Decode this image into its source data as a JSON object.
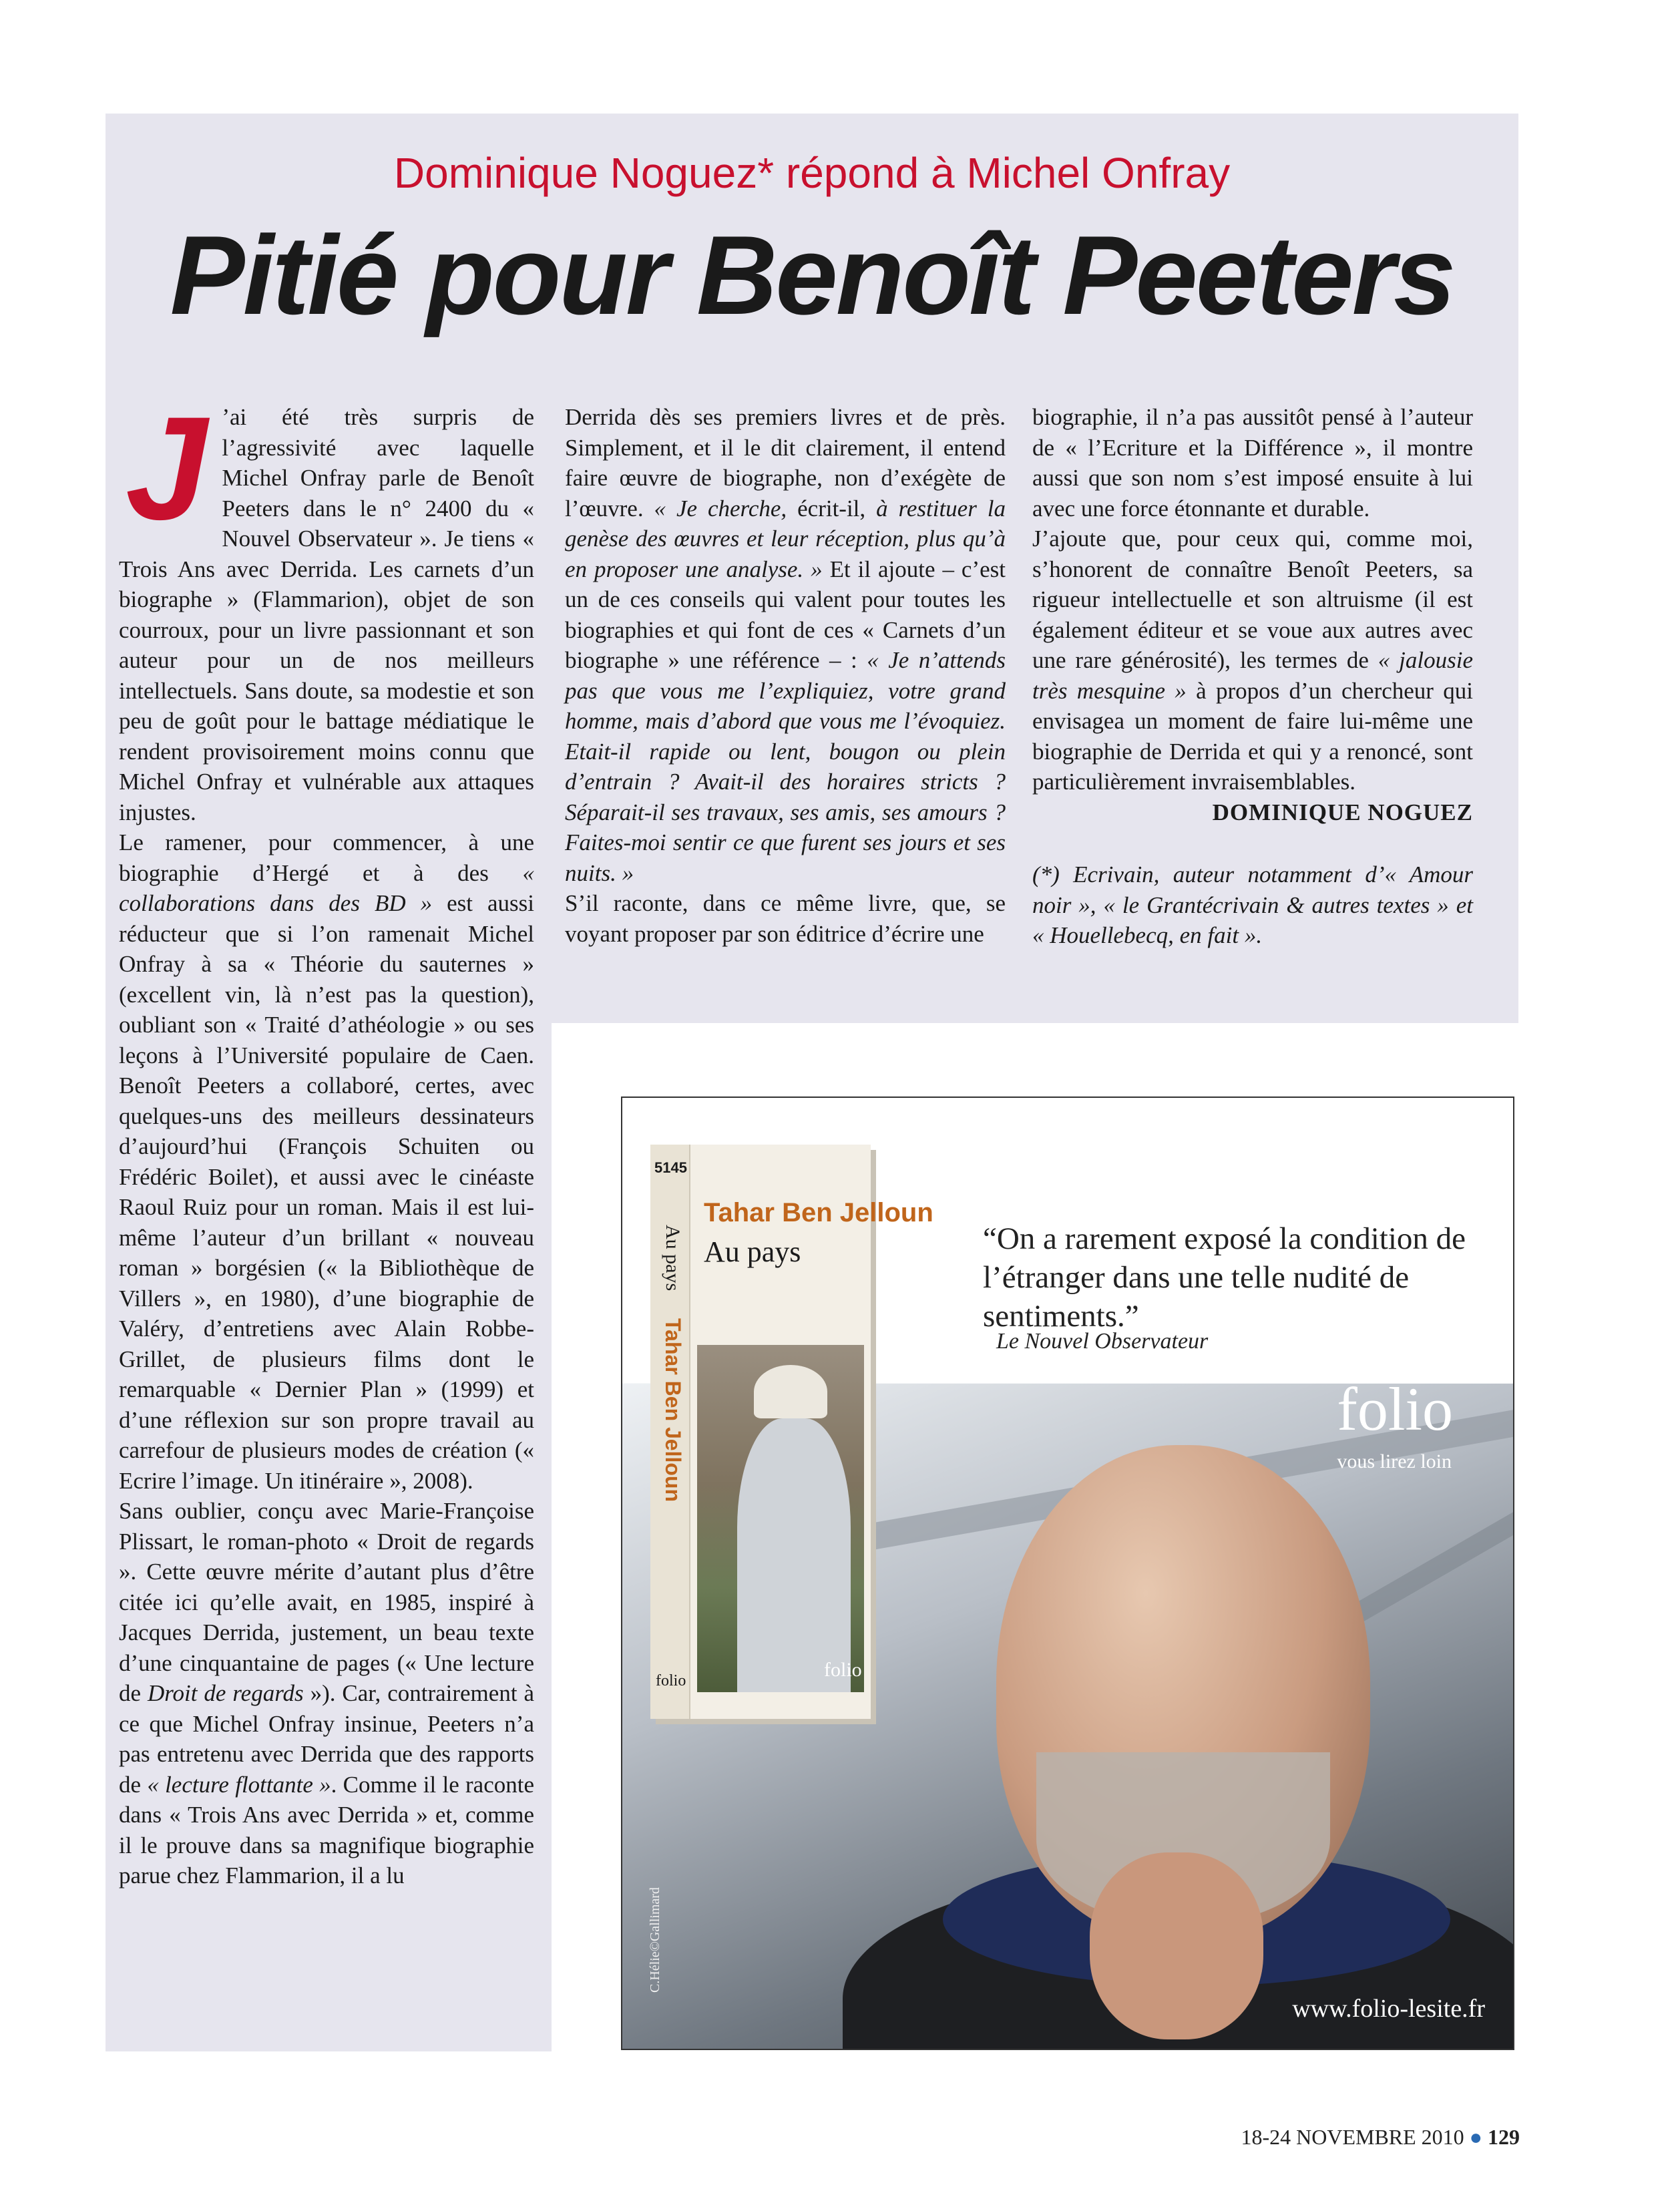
{
  "header": {
    "kicker": "Dominique Noguez* répond à Michel Onfray",
    "headline": "Pitié pour Benoît Peeters"
  },
  "article": {
    "dropcap": "J",
    "col1": {
      "p1_rest": "’ai été très surpris de l’agressivité avec laquelle Michel Onfray parle de Benoît Peeters dans le n° 2400 du « Nouvel Observateur ». Je tiens « Trois Ans avec Derrida. Les carnets d’un biographe » (Flammarion), objet de son courroux, pour un livre passionnant et son auteur pour un de nos meilleurs intellectuels. Sans doute, sa modestie et son peu de goût pour le battage médiatique le rendent provisoirement moins connu que Michel Onfray et vulnérable aux attaques injustes.",
      "p2_a": "Le ramener, pour commencer, à une biographie d’Hergé et à des ",
      "p2_em": "« collaborations dans des BD »",
      "p2_b": " est aussi réducteur que si l’on ramenait Michel Onfray à sa « Théorie du sauternes » (excellent vin, là n’est pas la question), oubliant son « Traité d’athéologie » ou ses leçons à l’Université populaire de Caen. Benoît Peeters a collaboré, certes, avec quelques-uns des meilleurs dessinateurs d’aujourd’hui (François Schuiten ou Frédéric Boilet), et aussi avec le cinéaste Raoul Ruiz pour un roman. Mais il est lui-même l’auteur d’un brillant « nouveau roman » borgésien (« la Bibliothèque de Villers », en 1980), d’une biographie de Valéry, d’entretiens avec Alain Robbe-Grillet, de plusieurs films dont le remarquable « Dernier Plan » (1999) et d’une réflexion sur son propre travail au carrefour de plusieurs modes de création (« Ecrire l’image. Un itinéraire », 2008).",
      "p3_a": "Sans oublier, conçu avec Marie-Françoise Plissart, le roman-photo « Droit de regards ». Cette œuvre mérite d’autant plus d’être citée ici qu’elle avait, en 1985, inspiré à Jacques Derrida, justement, un beau texte d’une cinquantaine de pages (« Une lecture de ",
      "p3_em": "Droit de regards",
      "p3_b": " »). Car, contrairement à ce que Michel Onfray insinue, Peeters n’a pas entretenu avec Derrida que des rapports de ",
      "p3_em2": "« lecture flottante »",
      "p3_c": ". Comme il le raconte dans « Trois Ans avec Derrida » et, comme il le prouve dans sa magnifique biographie parue chez Flammarion, il a lu"
    },
    "col2": {
      "p1_a": "Derrida dès ses premiers livres et de près. Simplement, et il le dit clairement, il entend faire œuvre de biographe, non d’exégète de l’œuvre. ",
      "p1_em1": "« Je cherche,",
      "p1_b": " écrit-il, ",
      "p1_em2": "à restituer la genèse des œuvres et leur réception, plus qu’à en proposer une analyse. »",
      "p1_c": " Et il ajoute – c’est un de ces conseils qui valent pour toutes les biographies et qui font de ces « Carnets d’un biographe » une référence – : ",
      "p1_em3": "« Je n’attends pas que vous me l’expliquiez, votre grand homme, mais d’abord que vous me l’évoquiez. Etait-il rapide ou lent, bougon ou plein d’entrain ? Avait-il des horaires stricts ? Séparait-il ses travaux, ses amis, ses amours ? Faites-moi sentir ce que furent ses jours et ses nuits. »",
      "p2": "S’il raconte, dans ce même livre, que, se voyant proposer par son éditrice d’écrire une"
    },
    "col3": {
      "p1": "biographie, il n’a pas aussitôt pensé à l’auteur de « l’Ecriture et la Différence », il montre aussi que son nom s’est imposé ensuite à lui avec une force étonnante et durable.",
      "p2_a": "J’ajoute que, pour ceux qui, comme moi, s’honorent de connaître Benoît Peeters, sa rigueur intellectuelle et son altruisme (il est également éditeur et se voue aux autres avec une rare générosité), les termes de ",
      "p2_em": "« jalousie très mesquine »",
      "p2_b": " à propos d’un chercheur qui envisagea un moment de faire lui-même une biographie de Derrida et qui y a renoncé, sont particulièrement invraisemblables.",
      "signature": "DOMINIQUE NOGUEZ",
      "footnote": "(*) Ecrivain, auteur notamment d’« Amour noir », « le Grantécrivain & autres textes » et « Houellebecq, en fait »."
    }
  },
  "ad": {
    "book_number": "5145",
    "book_author": "Tahar Ben Jelloun",
    "book_title": "Au pays",
    "book_brand": "folio",
    "quote": "“On a rarement exposé la condition de l’étranger dans une telle nudité de sentiments.”",
    "quote_source": "Le Nouvel Observateur",
    "logo": "folio",
    "tagline": "vous lirez loin",
    "photo_credit": "C.Hélie©Gallimard",
    "website": "www.folio-lesite.fr"
  },
  "footer": {
    "date": "18-24 NOVEMBRE 2010",
    "bullet": "●",
    "page": "129"
  },
  "colors": {
    "accent_red": "#c8102e",
    "panel_bg": "#e6e5ee",
    "book_author_orange": "#c0651b",
    "bullet_blue": "#2a6ab3"
  }
}
